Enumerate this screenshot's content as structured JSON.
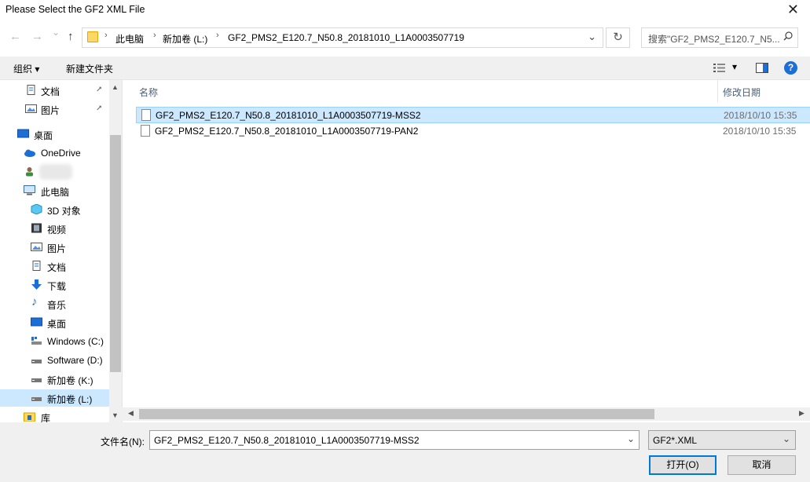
{
  "window": {
    "title": "Please Select the GF2 XML File",
    "close_symbol": "✕"
  },
  "nav": {
    "back_symbol": "←",
    "forward_symbol": "→",
    "history_symbol": "⌄",
    "up_symbol": "↑",
    "breadcrumbs": [
      "此电脑",
      "新加卷 (L:)",
      "GF2_PMS2_E120.7_N50.8_20181010_L1A0003507719"
    ],
    "crumb_sep": "›",
    "dropdown_symbol": "⌄",
    "refresh_symbol": "↻",
    "search_placeholder": "搜索\"GF2_PMS2_E120.7_N5..."
  },
  "toolbar": {
    "organize": "组织 ▾",
    "new_folder": "新建文件夹",
    "view_dd": "▾",
    "help": "?"
  },
  "sidebar": {
    "quick": [
      {
        "label": "文档",
        "icon": "document-icon"
      },
      {
        "label": "图片",
        "icon": "picture-icon"
      }
    ],
    "desktop": "桌面",
    "onedrive": "OneDrive",
    "this_pc": "此电脑",
    "pc_items": [
      {
        "label": "3D 对象",
        "icon": "3d-objects-icon"
      },
      {
        "label": "视频",
        "icon": "video-icon"
      },
      {
        "label": "图片",
        "icon": "picture-icon"
      },
      {
        "label": "文档",
        "icon": "document-icon"
      },
      {
        "label": "下载",
        "icon": "download-icon"
      },
      {
        "label": "音乐",
        "icon": "music-icon"
      },
      {
        "label": "桌面",
        "icon": "desktop-icon"
      },
      {
        "label": "Windows (C:)",
        "icon": "windows-drive-icon"
      },
      {
        "label": "Software (D:)",
        "icon": "drive-icon"
      },
      {
        "label": "新加卷 (K:)",
        "icon": "drive-icon"
      },
      {
        "label": "新加卷 (L:)",
        "icon": "drive-icon"
      }
    ],
    "library": "库",
    "pin_symbol": "📌",
    "up_arrow": "▲",
    "down_arrow": "▼"
  },
  "filelist": {
    "columns": {
      "name": "名称",
      "modified": "修改日期"
    },
    "files": [
      {
        "name": "GF2_PMS2_E120.7_N50.8_20181010_L1A0003507719-MSS2",
        "date": "2018/10/10 15:35",
        "selected": true
      },
      {
        "name": "GF2_PMS2_E120.7_N50.8_20181010_L1A0003507719-PAN2",
        "date": "2018/10/10 15:35",
        "selected": false
      }
    ],
    "left_arrow": "◀",
    "right_arrow": "▶"
  },
  "footer": {
    "filename_label": "文件名(N):",
    "filename_value": "GF2_PMS2_E120.7_N50.8_20181010_L1A0003507719-MSS2",
    "dropdown_symbol": "⌄",
    "filter_value": "GF2*.XML",
    "open_label": "打开(O)",
    "cancel_label": "取消"
  },
  "colors": {
    "selection": "#cce8ff",
    "accent": "#0078d7",
    "folder": "#ffd767"
  }
}
